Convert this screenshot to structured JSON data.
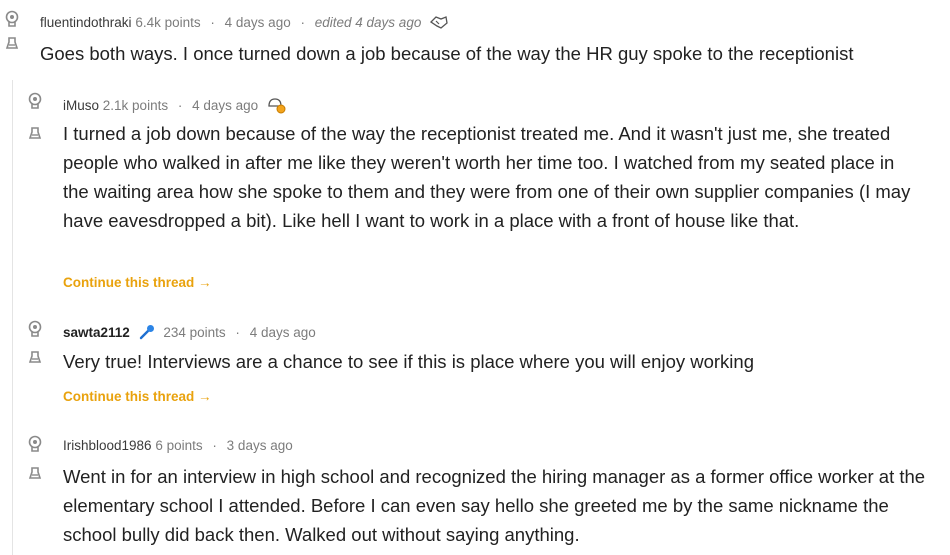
{
  "comments": [
    {
      "username": "fluentindothraki",
      "points": "6.4k points",
      "time": "4 days ago",
      "edited": "edited 4 days ago",
      "body": "Goes both ways. I once turned down a job because of the way the HR guy spoke to the receptionist",
      "award_icon": "handshake-award-icon"
    },
    {
      "username": "iMuso",
      "points": "2.1k points",
      "time": "4 days ago",
      "body": "I turned a job down because of the way the receptionist treated me. And it wasn't just me, she treated people who walked in after me like they weren't worth her time too. I watched from my seated place in the waiting area how she spoke to them and they were from one of their own supplier companies (I may have eavesdropped a bit). Like hell I want to work in a place with a front of house like that.",
      "award_icon": "wholesome-award-icon",
      "continue": "Continue this thread →"
    },
    {
      "username": "sawta2112",
      "points": "234 points",
      "time": "4 days ago",
      "body": "Very true! Interviews are a chance to see if this is place where you will enjoy working",
      "flair_icon": "microphone-icon",
      "continue": "Continue this thread →"
    },
    {
      "username": "Irishblood1986",
      "points": "6 points",
      "time": "3 days ago",
      "body": "Went in for an interview in high school and recognized the hiring manager as a former office worker at the elementary school I attended. Before I can even say hello she greeted me by the same nickname the school bully did back then. Walked out without saying anything."
    }
  ],
  "colors": {
    "link_orange": "#e9a20d",
    "meta_gray": "#7c7c7c",
    "thread_line": "#e4e4e4"
  }
}
